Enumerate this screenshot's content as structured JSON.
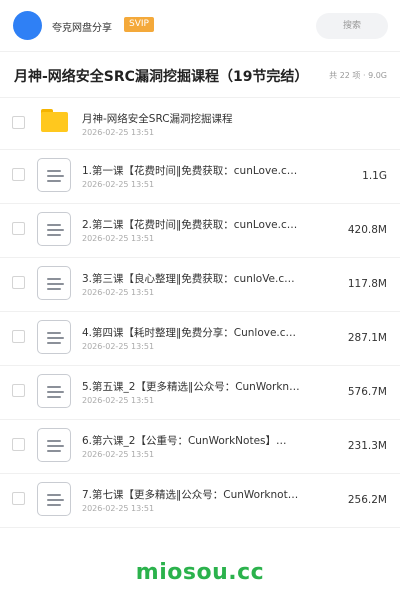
{
  "header": {
    "owner_name": "夸克网盘分享",
    "badge": "SVIP",
    "search_placeholder": "搜索",
    "avatar_color": "#2f80f5",
    "badge_color": "#f4a93a"
  },
  "folder": {
    "title": "月神-网络安全SRC漏洞挖掘课程（19节完结）",
    "meta": "共 22 项 · 9.0G"
  },
  "items": [
    {
      "type": "folder",
      "name": "月神-网络安全SRC漏洞挖掘课程",
      "date": "2026-02-25 13:51",
      "size": ""
    },
    {
      "type": "file",
      "name": "1.第一课【花费时间‖免费获取：cunLove.c…",
      "date": "2026-02-25 13:51",
      "size": "1.1G"
    },
    {
      "type": "file",
      "name": "2.第二课【花费时间‖免费获取：cunLove.c…",
      "date": "2026-02-25 13:51",
      "size": "420.8M"
    },
    {
      "type": "file",
      "name": "3.第三课【良心整理‖免费获取：cunloVe.c…",
      "date": "2026-02-25 13:51",
      "size": "117.8M"
    },
    {
      "type": "file",
      "name": "4.第四课【耗时整理‖免费分享：Cunlove.c…",
      "date": "2026-02-25 13:51",
      "size": "287.1M"
    },
    {
      "type": "file",
      "name": "5.第五课_2【更多精选‖公众号：CunWorkn…",
      "date": "2026-02-25 13:51",
      "size": "576.7M"
    },
    {
      "type": "file",
      "name": "6.第六课_2【公重号：CunWorkNotes】…",
      "date": "2026-02-25 13:51",
      "size": "231.3M"
    },
    {
      "type": "file",
      "name": "7.第七课【更多精选‖公众号：CunWorknot…",
      "date": "2026-02-25 13:51",
      "size": "256.2M"
    }
  ],
  "watermark": "miosou.cc",
  "watermark_color": "#2bb24c"
}
